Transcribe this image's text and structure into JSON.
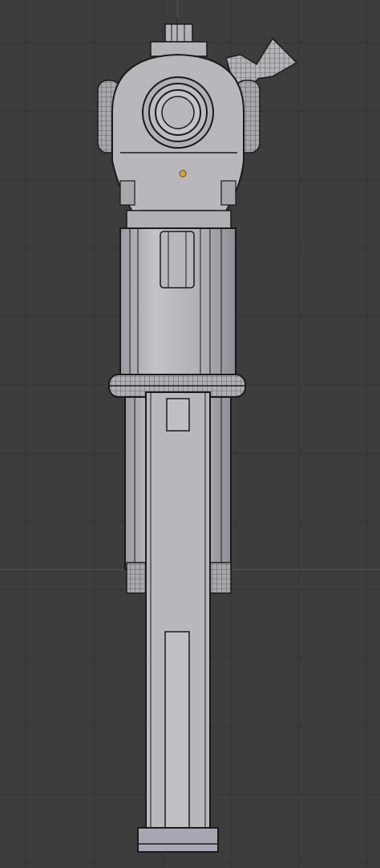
{
  "viewport": {
    "background_color": "#3d3d3d",
    "grid_color": "#353535",
    "x_axis_color": "#8a3b3b",
    "z_axis_color": "#4d4d9a"
  },
  "model": {
    "fill_color": "#b4b4b8",
    "edge_color": "#1a1a1a",
    "highlight_color": "#c8c8cc",
    "shadow_color": "#8e8e96",
    "vertex_marker_color": "#e09a40"
  }
}
